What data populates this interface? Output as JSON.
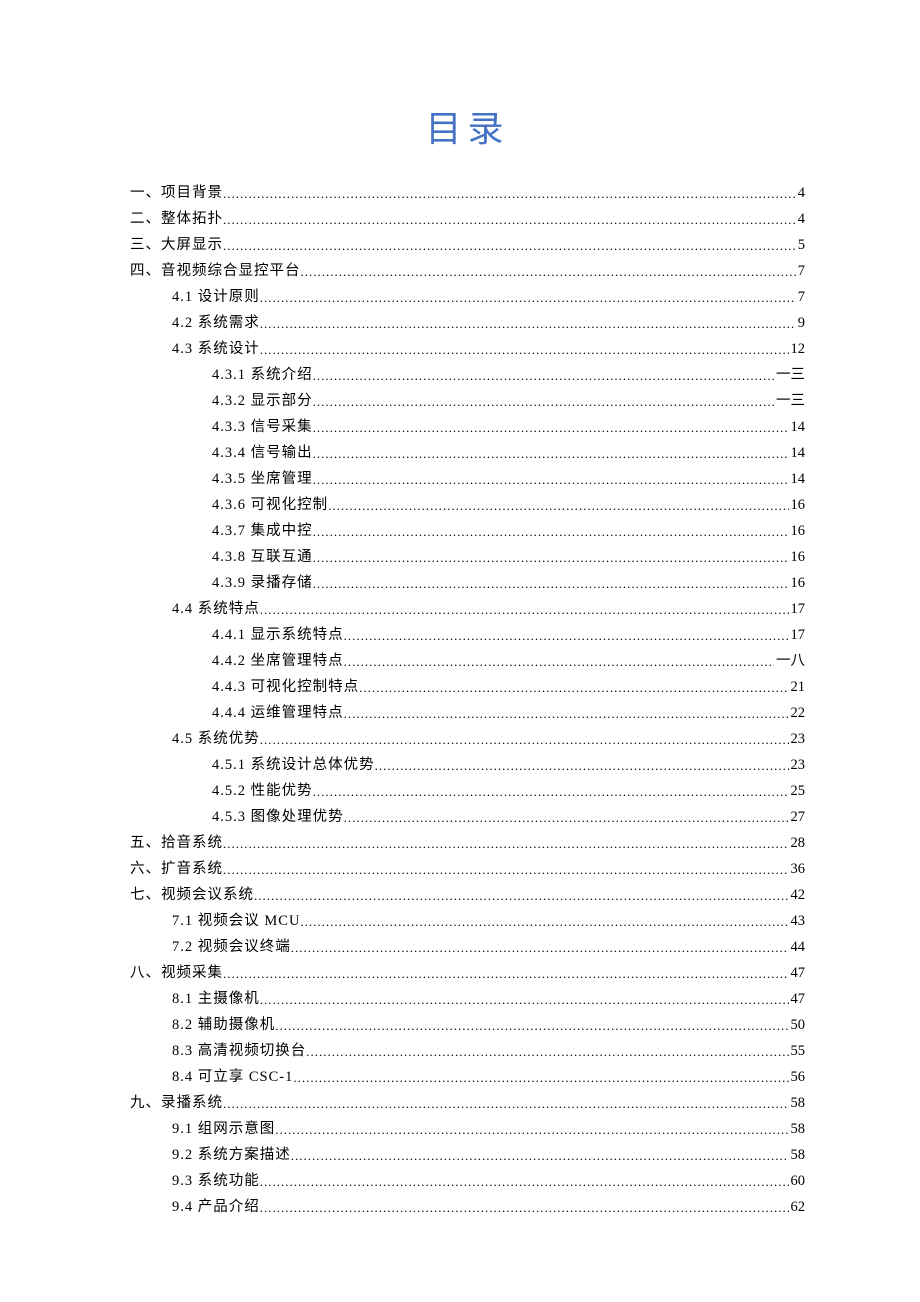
{
  "title": "目录",
  "toc": [
    {
      "level": 0,
      "label": "一、项目背景",
      "page": "4"
    },
    {
      "level": 0,
      "label": "二、整体拓扑",
      "page": "4"
    },
    {
      "level": 0,
      "label": "三、大屏显示",
      "page": "5"
    },
    {
      "level": 0,
      "label": "四、音视频综合显控平台",
      "page": "7"
    },
    {
      "level": 1,
      "label": "4.1 设计原则",
      "page": "7"
    },
    {
      "level": 1,
      "label": "4.2 系统需求",
      "page": "9"
    },
    {
      "level": 1,
      "label": "4.3 系统设计",
      "page": "12"
    },
    {
      "level": 2,
      "label": "4.3.1 系统介绍",
      "page": "一三"
    },
    {
      "level": 2,
      "label": "4.3.2 显示部分",
      "page": "一三"
    },
    {
      "level": 2,
      "label": "4.3.3 信号采集",
      "page": "14"
    },
    {
      "level": 2,
      "label": "4.3.4 信号输出",
      "page": "14"
    },
    {
      "level": 2,
      "label": "4.3.5 坐席管理",
      "page": "14"
    },
    {
      "level": 2,
      "label": "4.3.6 可视化控制",
      "page": "16"
    },
    {
      "level": 2,
      "label": "4.3.7 集成中控",
      "page": "16"
    },
    {
      "level": 2,
      "label": "4.3.8 互联互通",
      "page": "16"
    },
    {
      "level": 2,
      "label": "4.3.9 录播存储",
      "page": "16"
    },
    {
      "level": 1,
      "label": "4.4 系统特点",
      "page": "17"
    },
    {
      "level": 2,
      "label": "4.4.1 显示系统特点",
      "page": "17"
    },
    {
      "level": 2,
      "label": "4.4.2 坐席管理特点",
      "page": "一八"
    },
    {
      "level": 2,
      "label": "4.4.3 可视化控制特点",
      "page": "21"
    },
    {
      "level": 2,
      "label": "4.4.4 运维管理特点",
      "page": "22"
    },
    {
      "level": 1,
      "label": "4.5 系统优势",
      "page": "23"
    },
    {
      "level": 2,
      "label": "4.5.1 系统设计总体优势",
      "page": "23"
    },
    {
      "level": 2,
      "label": "4.5.2 性能优势",
      "page": "25"
    },
    {
      "level": 2,
      "label": "4.5.3 图像处理优势",
      "page": "27"
    },
    {
      "level": 0,
      "label": "五、拾音系统",
      "page": "28"
    },
    {
      "level": 0,
      "label": "六、扩音系统",
      "page": "36"
    },
    {
      "level": 0,
      "label": "七、视频会议系统",
      "page": "42"
    },
    {
      "level": 1,
      "label": "7.1 视频会议 MCU",
      "page": "43"
    },
    {
      "level": 1,
      "label": "7.2 视频会议终端",
      "page": "44"
    },
    {
      "level": 0,
      "label": "八、视频采集",
      "page": "47"
    },
    {
      "level": 1,
      "label": "8.1 主摄像机",
      "page": "47"
    },
    {
      "level": 1,
      "label": "8.2 辅助摄像机",
      "page": "50"
    },
    {
      "level": 1,
      "label": "8.3 高清视频切换台",
      "page": "55"
    },
    {
      "level": 1,
      "label": "8.4 可立享 CSC-1",
      "page": "56"
    },
    {
      "level": 0,
      "label": "九、录播系统",
      "page": "58"
    },
    {
      "level": 1,
      "label": "9.1 组网示意图",
      "page": "58"
    },
    {
      "level": 1,
      "label": "9.2 系统方案描述",
      "page": "58"
    },
    {
      "level": 1,
      "label": "9.3 系统功能",
      "page": "60"
    },
    {
      "level": 1,
      "label": "9.4 产品介绍",
      "page": "62"
    }
  ]
}
